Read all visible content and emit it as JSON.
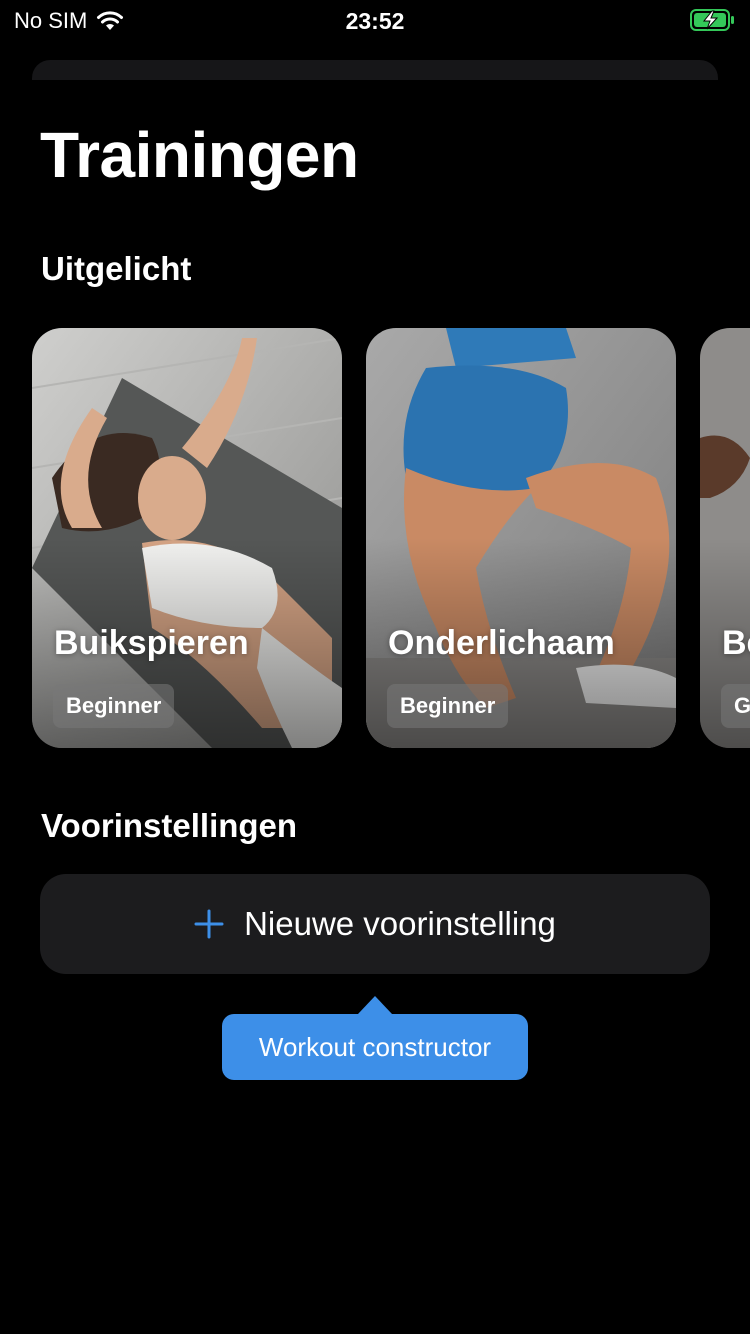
{
  "status_bar": {
    "carrier": "No SIM",
    "time": "23:52",
    "wifi_icon": "wifi-icon",
    "battery_icon": "battery-charging-icon",
    "battery_color": "#34c759"
  },
  "page": {
    "title": "Trainingen"
  },
  "featured": {
    "heading": "Uitgelicht",
    "cards": [
      {
        "title": "Buikspieren",
        "level": "Beginner"
      },
      {
        "title": "Onderlichaam",
        "level": "Beginner"
      },
      {
        "title": "Be",
        "level": "G"
      }
    ]
  },
  "presets": {
    "heading": "Voorinstellingen",
    "new_button_label": "Nieuwe voorinstelling",
    "new_button_icon": "plus-icon",
    "accent_color": "#3d8fe8"
  },
  "tooltip": {
    "text": "Workout constructor",
    "color": "#3d8fe8"
  }
}
